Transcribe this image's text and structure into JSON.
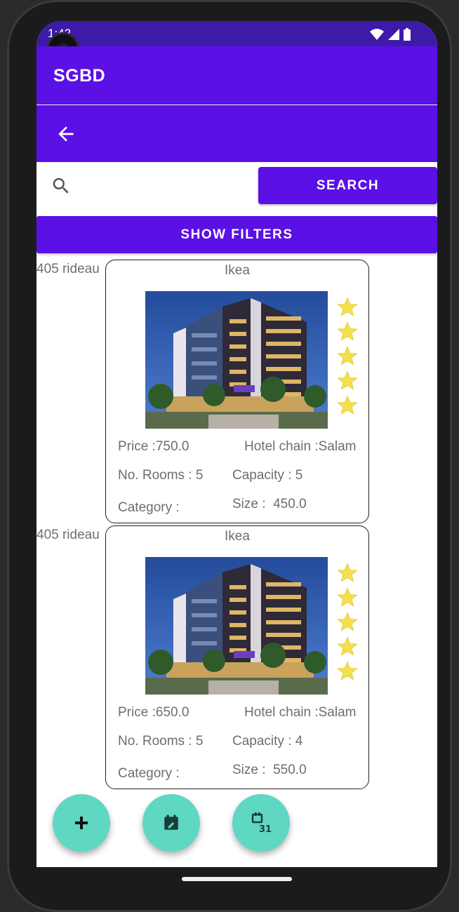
{
  "status_bar": {
    "time": "1:42"
  },
  "app": {
    "title": "SGBD"
  },
  "search": {
    "placeholder": "",
    "button_label": "SEARCH"
  },
  "filters": {
    "button_label": "SHOW FILTERS"
  },
  "colors": {
    "primary": "#5b10e6",
    "fab": "#5ed7c3",
    "star": "#f4e04d"
  },
  "hotels": [
    {
      "address": "405 rideau",
      "name": "Ikea",
      "stars": 5,
      "price_label": "Price :",
      "price": "750.0",
      "chain_label": "Hotel chain :",
      "chain": "Salam",
      "rooms_label": "No. Rooms :",
      "rooms": "5",
      "capacity_label": "Capacity :",
      "capacity": "5",
      "category_label": "Category :",
      "category": "",
      "size_label": "Size :",
      "size": "450.0"
    },
    {
      "address": "405 rideau",
      "name": "Ikea",
      "stars": 5,
      "price_label": "Price :",
      "price": "650.0",
      "chain_label": "Hotel chain :",
      "chain": "Salam",
      "rooms_label": "No. Rooms :",
      "rooms": "5",
      "capacity_label": "Capacity :",
      "capacity": "4",
      "category_label": "Category :",
      "category": "",
      "size_label": "Size :",
      "size": "550.0"
    }
  ],
  "fabs": [
    {
      "icon": "add-icon"
    },
    {
      "icon": "calendar-note-icon"
    },
    {
      "icon": "calendar-31-icon"
    }
  ]
}
